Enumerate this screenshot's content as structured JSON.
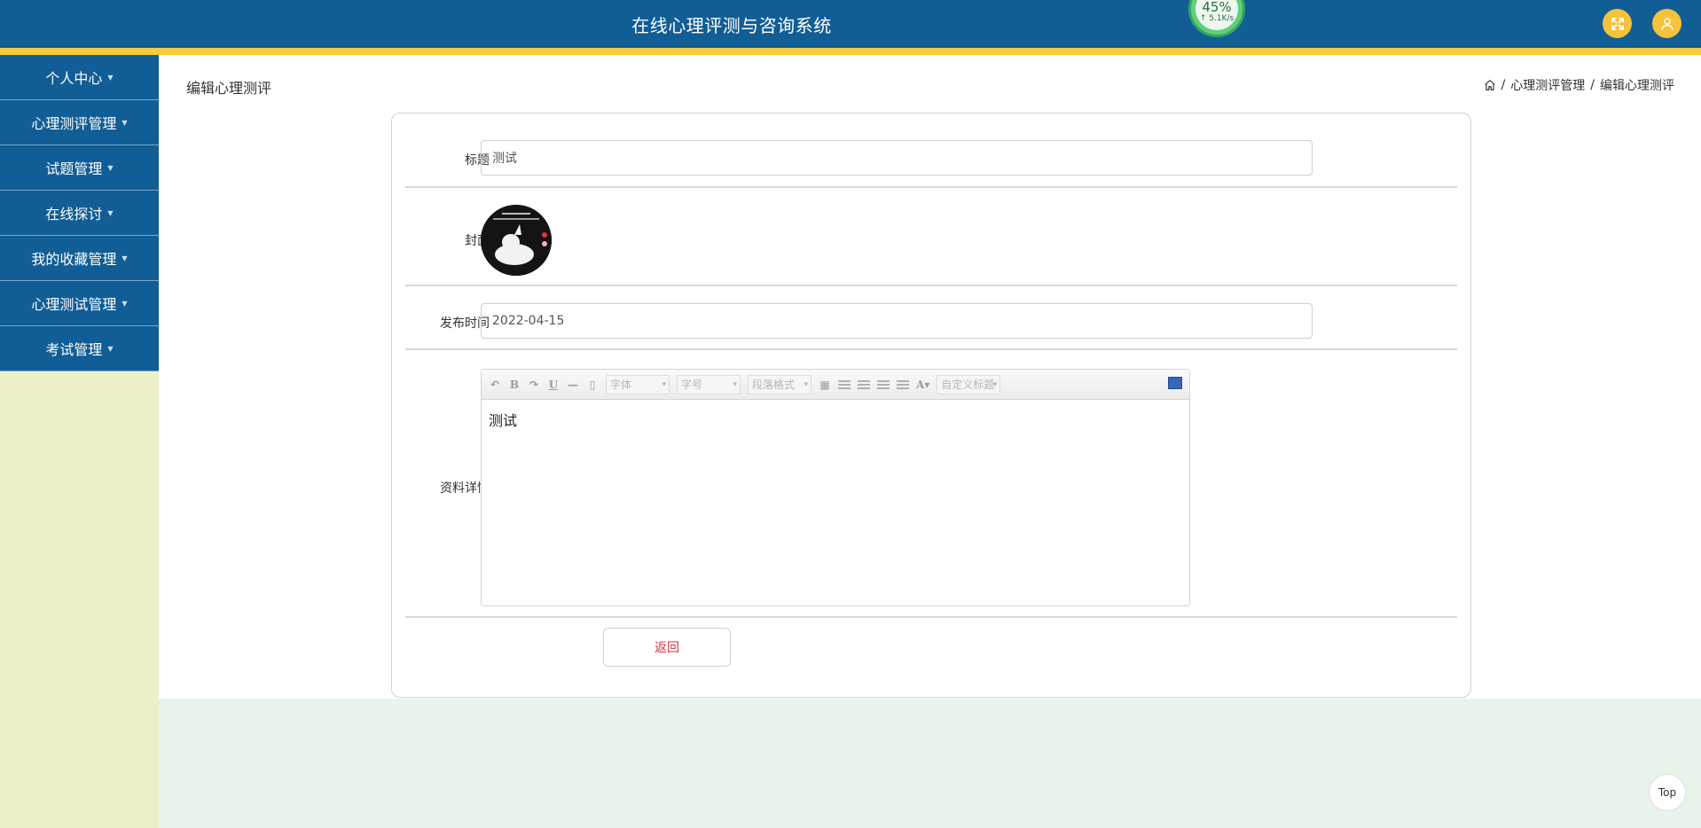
{
  "header": {
    "title": "在线心理评测与咨询系统",
    "net_percent": "45%",
    "net_speed": "↑ 5.1K/s",
    "accent": "#f5c23a",
    "bar_color": "#115d96"
  },
  "sidebar": {
    "items": [
      {
        "label": "个人中心"
      },
      {
        "label": "心理测评管理"
      },
      {
        "label": "试题管理"
      },
      {
        "label": "在线探讨"
      },
      {
        "label": "我的收藏管理"
      },
      {
        "label": "心理测试管理"
      },
      {
        "label": "考试管理"
      }
    ]
  },
  "page": {
    "title": "编辑心理测评",
    "breadcrumb": [
      "心理测评管理",
      "编辑心理测评"
    ]
  },
  "form": {
    "title_label": "标题",
    "title_value": "测试",
    "cover_label": "封面",
    "date_label": "发布时间",
    "date_value": "2022-04-15",
    "detail_label": "资料详情",
    "editor": {
      "font_placeholder": "字体",
      "size_placeholder": "字号",
      "paragraph_placeholder": "段落格式",
      "custom_title_placeholder": "自定义标题",
      "content": "测试"
    },
    "return_label": "返回"
  },
  "footer": {
    "top_label": "Top"
  }
}
